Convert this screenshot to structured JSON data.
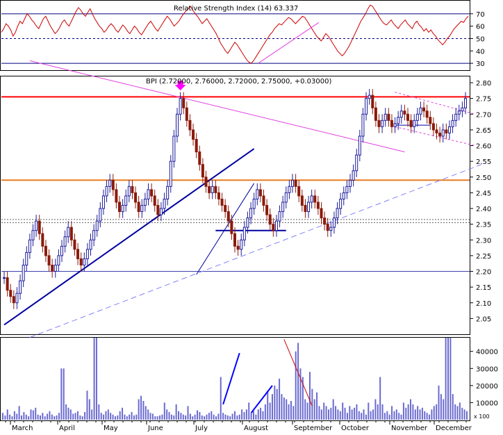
{
  "chart_data": [
    {
      "panel": "rsi",
      "type": "line",
      "title": "Relative Strength Index (14) 63.337",
      "ylim": [
        25,
        80
      ],
      "yticks": [
        30,
        40,
        50,
        60,
        70
      ],
      "reference_lines": {
        "solid": [
          70,
          30
        ],
        "dashed": [
          50
        ]
      },
      "colors": {
        "line": "#cc0000",
        "ref": "#000080",
        "trend": "#e040e0"
      },
      "values": [
        55,
        58,
        62,
        60,
        57,
        52,
        55,
        60,
        64,
        62,
        66,
        70,
        68,
        65,
        63,
        60,
        58,
        62,
        66,
        68,
        64,
        60,
        57,
        54,
        56,
        59,
        63,
        65,
        62,
        60,
        64,
        68,
        72,
        75,
        73,
        70,
        68,
        71,
        74,
        70,
        66,
        63,
        60,
        58,
        55,
        57,
        60,
        62,
        60,
        57,
        55,
        58,
        61,
        59,
        56,
        54,
        57,
        60,
        58,
        55,
        53,
        56,
        59,
        62,
        64,
        61,
        58,
        56,
        59,
        62,
        65,
        68,
        66,
        63,
        60,
        62,
        64,
        67,
        70,
        72,
        74,
        76,
        73,
        70,
        68,
        65,
        62,
        64,
        66,
        63,
        60,
        57,
        54,
        50,
        46,
        43,
        40,
        38,
        41,
        44,
        47,
        45,
        42,
        39,
        36,
        33,
        31,
        30,
        32,
        35,
        38,
        41,
        44,
        47,
        50,
        53,
        55,
        58,
        60,
        62,
        61,
        63,
        65,
        67,
        66,
        64,
        62,
        64,
        66,
        68,
        67,
        64,
        61,
        58,
        55,
        52,
        50,
        48,
        51,
        54,
        52,
        49,
        46,
        43,
        40,
        38,
        36,
        38,
        41,
        44,
        48,
        52,
        56,
        60,
        64,
        67,
        70,
        74,
        77,
        76,
        73,
        70,
        67,
        64,
        62,
        61,
        63,
        65,
        62,
        60,
        58,
        61,
        63,
        65,
        62,
        60,
        58,
        62,
        64,
        61,
        59,
        56,
        58,
        55,
        57,
        54,
        52,
        49,
        47,
        45,
        47,
        50,
        52,
        55,
        58,
        60,
        62,
        64,
        63,
        66,
        68
      ]
    },
    {
      "panel": "price",
      "type": "ohlc",
      "title": "BPI (2.72000, 2.76000, 2.72000, 2.75000, +0.03000)",
      "ylim": [
        2.0,
        2.82
      ],
      "yticks": [
        2.05,
        2.1,
        2.15,
        2.2,
        2.25,
        2.3,
        2.35,
        2.4,
        2.45,
        2.5,
        2.55,
        2.6,
        2.65,
        2.7,
        2.75,
        2.8
      ],
      "x_labels": [
        "March",
        "April",
        "May",
        "June",
        "July",
        "August",
        "September",
        "October",
        "November",
        "December"
      ],
      "colors": {
        "up": "#1a1a9c",
        "down": "#8b1a0a",
        "resistance": "#ff0000",
        "support_orange": "#e87a1e",
        "support_blue": "#4040b0",
        "trend_blue": "#0000a0",
        "trend_magenta": "#e040e0",
        "dashed_blue": "#8080ff"
      },
      "horizontal_lines": {
        "red": 2.755,
        "orange": 2.49,
        "blue": 2.2,
        "dashed": [
          2.355,
          2.365
        ]
      },
      "closes": [
        2.18,
        2.14,
        2.12,
        2.1,
        2.13,
        2.17,
        2.22,
        2.26,
        2.3,
        2.33,
        2.36,
        2.32,
        2.28,
        2.25,
        2.22,
        2.2,
        2.22,
        2.25,
        2.28,
        2.31,
        2.34,
        2.3,
        2.27,
        2.24,
        2.22,
        2.24,
        2.27,
        2.3,
        2.33,
        2.36,
        2.4,
        2.44,
        2.47,
        2.49,
        2.46,
        2.42,
        2.39,
        2.41,
        2.44,
        2.47,
        2.45,
        2.42,
        2.39,
        2.41,
        2.43,
        2.46,
        2.44,
        2.41,
        2.38,
        2.4,
        2.43,
        2.47,
        2.55,
        2.63,
        2.7,
        2.75,
        2.72,
        2.68,
        2.65,
        2.62,
        2.58,
        2.54,
        2.5,
        2.47,
        2.45,
        2.47,
        2.45,
        2.43,
        2.41,
        2.39,
        2.36,
        2.32,
        2.28,
        2.27,
        2.3,
        2.34,
        2.37,
        2.4,
        2.43,
        2.46,
        2.44,
        2.41,
        2.38,
        2.35,
        2.33,
        2.36,
        2.39,
        2.42,
        2.45,
        2.47,
        2.49,
        2.47,
        2.44,
        2.41,
        2.39,
        2.42,
        2.44,
        2.42,
        2.4,
        2.37,
        2.35,
        2.33,
        2.34,
        2.37,
        2.4,
        2.43,
        2.45,
        2.47,
        2.49,
        2.52,
        2.57,
        2.63,
        2.7,
        2.75,
        2.76,
        2.72,
        2.68,
        2.66,
        2.68,
        2.7,
        2.68,
        2.66,
        2.67,
        2.69,
        2.71,
        2.7,
        2.68,
        2.66,
        2.68,
        2.7,
        2.72,
        2.71,
        2.69,
        2.67,
        2.65,
        2.64,
        2.63,
        2.65,
        2.64,
        2.66,
        2.68,
        2.7,
        2.71,
        2.72,
        2.75
      ],
      "annotations": [
        {
          "kind": "arrow",
          "color": "#ff00ff",
          "target_bar": 55,
          "price": 2.78
        }
      ]
    },
    {
      "panel": "volume",
      "type": "bar",
      "ylim": [
        0,
        48000
      ],
      "yticks": [
        10000,
        20000,
        30000,
        40000
      ],
      "colors": {
        "bar": "#6a6ad0",
        "trend_blue": "#0000ff",
        "trend_red": "#cc0000"
      },
      "values": [
        4000,
        2500,
        6000,
        3000,
        2000,
        5000,
        3500,
        8000,
        2500,
        4500,
        3000,
        2000,
        6000,
        5500,
        7000,
        3000,
        2500,
        4000,
        2000,
        3500,
        5000,
        3000,
        2000,
        2500,
        4000,
        30000,
        30000,
        9000,
        7000,
        6000,
        3500,
        4000,
        5000,
        2500,
        2000,
        4500,
        17000,
        12000,
        6000,
        48000,
        48000,
        9000,
        4000,
        3000,
        5000,
        6000,
        4000,
        3000,
        2000,
        2500,
        5000,
        7000,
        3000,
        2000,
        3000,
        4500,
        2500,
        3000,
        12000,
        14000,
        11000,
        8000,
        6000,
        4000,
        3500,
        2000,
        2000,
        2500,
        3000,
        10000,
        6000,
        4500,
        3000,
        2500,
        9000,
        5000,
        4000,
        3000,
        2500,
        8000,
        3500,
        2000,
        3000,
        5500,
        4500,
        2500,
        2000,
        3000,
        4000,
        5000,
        3000,
        2000,
        3500,
        25000,
        4000,
        3000,
        2500,
        2000,
        3500,
        5000,
        2500,
        3000,
        6000,
        4500,
        6000,
        10000,
        4000,
        5000,
        3000,
        6000,
        7000,
        5000,
        9000,
        17000,
        10000,
        15000,
        20000,
        18000,
        24000,
        15000,
        13000,
        12000,
        9000,
        11000,
        8000,
        40000,
        45000,
        30000,
        25000,
        12000,
        10000,
        28000,
        18000,
        12000,
        16000,
        8000,
        6000,
        10000,
        8000,
        6000,
        7000,
        12000,
        8000,
        6000,
        5000,
        10000,
        7000,
        4000,
        8000,
        6000,
        7000,
        9000,
        5000,
        4000,
        6000,
        3000,
        10000,
        5000,
        6000,
        12000,
        9000,
        25000,
        9000,
        4000,
        5000,
        3000,
        8000,
        5000,
        6000,
        4000,
        3000,
        10000,
        7000,
        9000,
        12000,
        9000,
        6000,
        8000,
        6000,
        7000,
        5000,
        4000,
        3000,
        6000,
        8000,
        9000,
        20000,
        15000,
        12000,
        48000,
        48000,
        48000,
        15000,
        9000,
        8000,
        10000,
        7000,
        6000,
        5000
      ]
    }
  ],
  "rsi_ticks": [
    "30",
    "40",
    "50",
    "60",
    "70"
  ],
  "price_ticks": [
    "2.05",
    "2.10",
    "2.15",
    "2.20",
    "2.25",
    "2.30",
    "2.35",
    "2.40",
    "2.45",
    "2.50",
    "2.55",
    "2.60",
    "2.65",
    "2.70",
    "2.75",
    "2.80"
  ],
  "volume_ticks": [
    "10000",
    "20000",
    "30000",
    "40000"
  ],
  "volume_scale": "x 100",
  "months": [
    "March",
    "April",
    "May",
    "June",
    "July",
    "August",
    "September",
    "October",
    "November",
    "December"
  ]
}
